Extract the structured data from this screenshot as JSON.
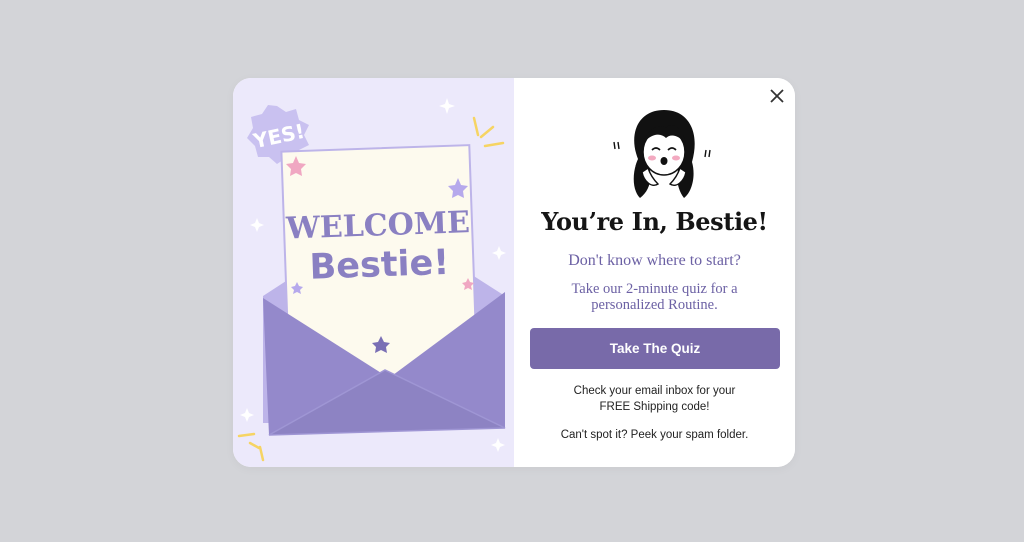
{
  "colors": {
    "page_bg": "#d3d4d8",
    "left_panel_bg": "#ece9fb",
    "accent": "#786aa9",
    "envelope": "#8d83c3",
    "letter": "#fdfaee"
  },
  "illustration": {
    "badge_text": "YES!",
    "letter_line1": "WELCOME",
    "letter_line2": "Bestie!"
  },
  "popup": {
    "close_icon": "close-icon",
    "title": "You’re In, Bestie!",
    "subtitle": "Don't know where to start?",
    "description": "Take our 2-minute quiz for a personalized Routine.",
    "cta_label": "Take The Quiz",
    "email_note_line1": "Check your email inbox for your",
    "email_note_line2": "FREE Shipping code!",
    "spam_note": "Can't spot it? Peek your spam folder."
  }
}
